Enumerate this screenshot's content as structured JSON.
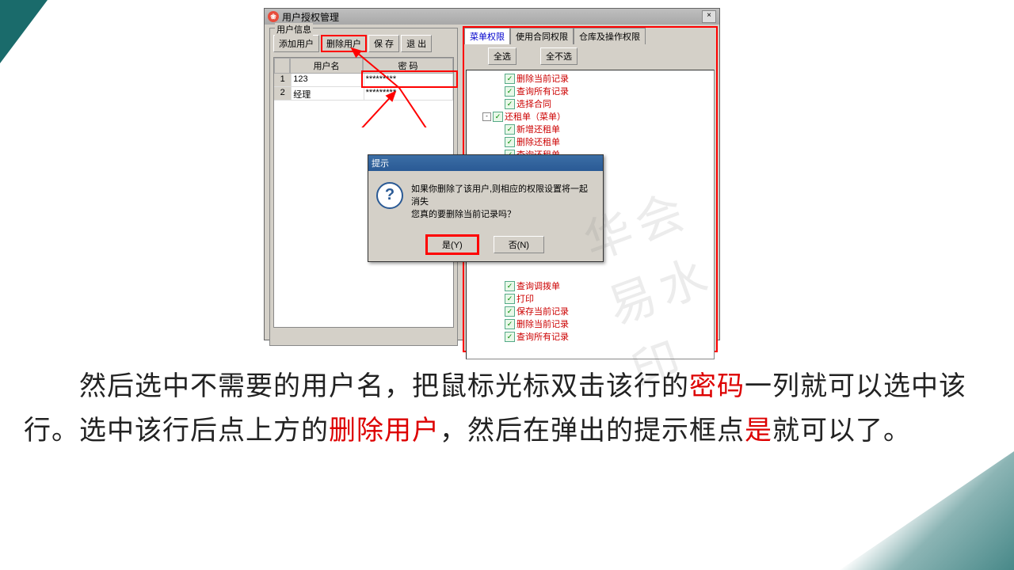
{
  "window": {
    "title": "用户授权管理"
  },
  "userbox": {
    "label": "用户信息",
    "buttons": {
      "add": "添加用户",
      "del": "删除用户",
      "save": "保 存",
      "exit": "退 出"
    },
    "headers": {
      "name": "用户名",
      "pwd": "密 码"
    },
    "rows": [
      {
        "n": "1",
        "name": "123",
        "pwd": "*********"
      },
      {
        "n": "2",
        "name": "经理",
        "pwd": "*********"
      }
    ]
  },
  "tabs": {
    "t1": "菜单权限",
    "t2": "使用合同权限",
    "t3": "仓库及操作权限"
  },
  "sel": {
    "all": "全选",
    "none": "全不选"
  },
  "tree": [
    "删除当前记录",
    "查询所有记录",
    "选择合同",
    "还租单（菜单）",
    "新增还租单",
    "删除还租单",
    "查询还租单",
    "打印",
    "保存当前记录",
    "删除当前记录",
    "查询所有记录",
    "查询调拨单"
  ],
  "dialog": {
    "title": "提示",
    "line1": "如果你删除了该用户,则相应的权限设置将一起消失",
    "line2": "您真的要删除当前记录吗？",
    "yes": "是(Y)",
    "no": "否(N)"
  },
  "watermark": "华会易水印",
  "caption": {
    "p1a": "　　然后选中不需要的用户名，把鼠标光标双击该行的",
    "p1b": "密码",
    "p1c": "一列就可以选中该行。选中该行后点上方的",
    "p1d": "删除用户",
    "p1e": "，然后在弹出的提示框点",
    "p1f": "是",
    "p1g": "就可以了。"
  }
}
